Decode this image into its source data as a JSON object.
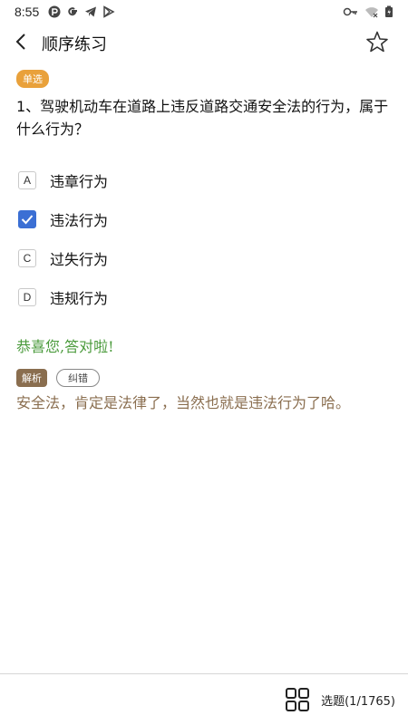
{
  "status_bar": {
    "time": "8:55",
    "left_icons": [
      "notification-p-icon",
      "google-icon",
      "telegram-icon",
      "play-store-icon"
    ],
    "right_icons": [
      "key-icon",
      "wifi-icon",
      "battery-icon"
    ]
  },
  "app_bar": {
    "title": "顺序练习",
    "back_icon": "back-arrow-icon",
    "favorite_icon": "star-outline-icon"
  },
  "question": {
    "type_badge": "单选",
    "text": "1、驾驶机动车在道路上违反道路交通安全法的行为，属于什么行为？",
    "options": [
      {
        "key": "A",
        "label": "违章行为",
        "checked": false
      },
      {
        "key": "",
        "label": "违法行为",
        "checked": true
      },
      {
        "key": "C",
        "label": "过失行为",
        "checked": false
      },
      {
        "key": "D",
        "label": "违规行为",
        "checked": false
      }
    ]
  },
  "result_text": "恭喜您,答对啦!",
  "analysis": {
    "tag": "解析",
    "report_button": "纠错",
    "text": "安全法，肯定是法律了，当然也就是违法行为了哈。"
  },
  "bottom_bar": {
    "grid_icon": "grid-icon",
    "select_label": "选题(1/1765)"
  },
  "colors": {
    "badge": "#e9a13b",
    "checked": "#3b6fd4",
    "correct": "#4a9a3b",
    "analysis": "#8a6e4f"
  }
}
